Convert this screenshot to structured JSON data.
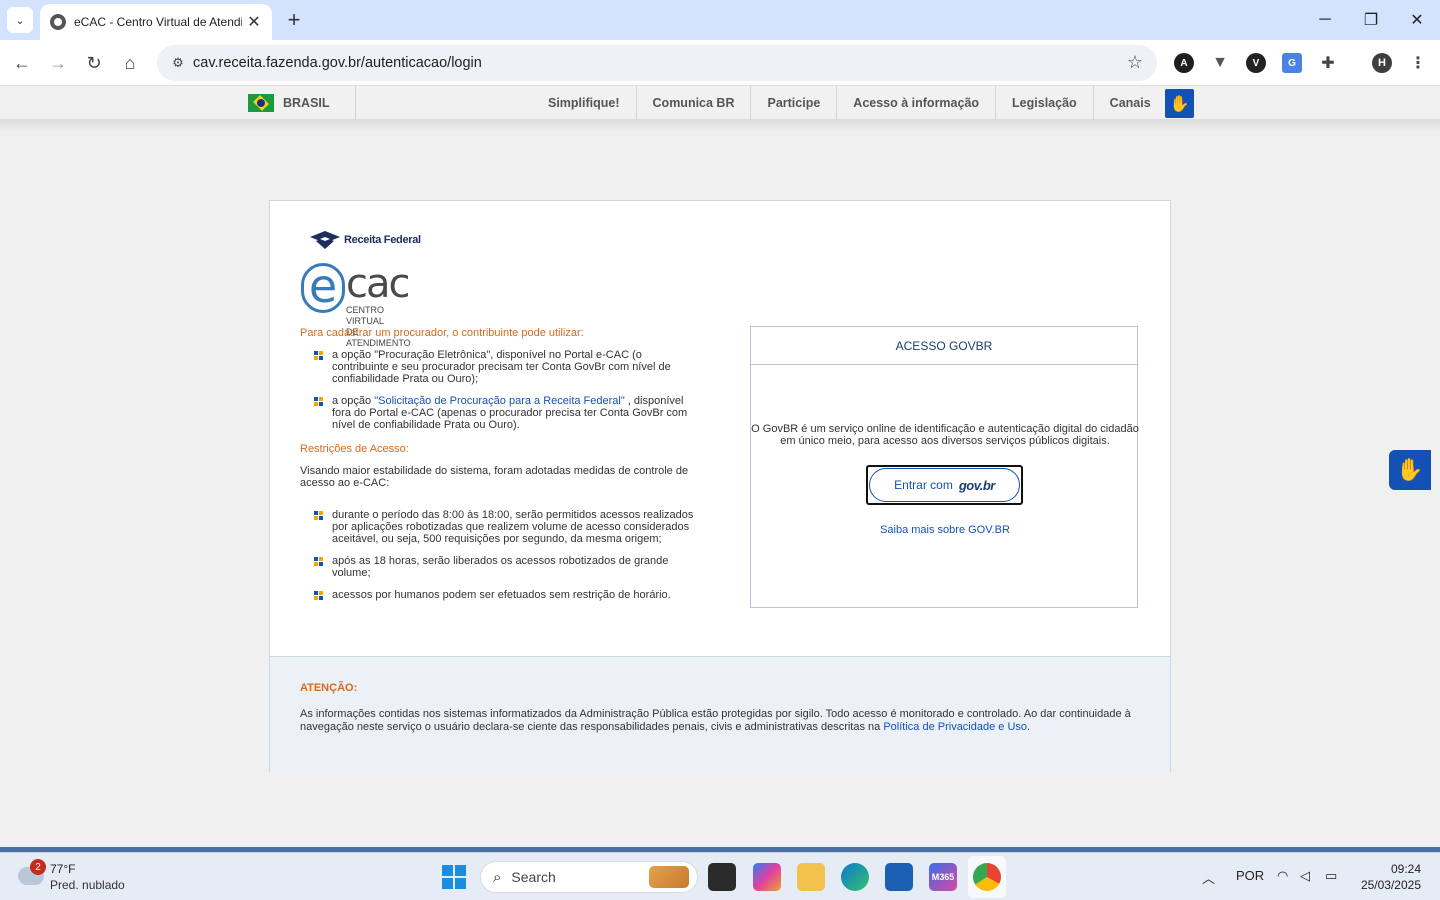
{
  "browser": {
    "tab_title": "eCAC - Centro Virtual de Atendimento",
    "url": "cav.receita.fazenda.gov.br/autenticacao/login",
    "profile_initial": "H"
  },
  "govbar": {
    "brasil": "BRASIL",
    "links": [
      "Simplifique!",
      "Comunica BR",
      "Participe",
      "Acesso à informação",
      "Legislação",
      "Canais"
    ]
  },
  "logo": {
    "receita": "Receita Federal",
    "ecac_text": "cac",
    "ecac_e": "e",
    "ecac_sub1": "CENTRO VIRTUAL",
    "ecac_sub2": "DE ATENDIMENTO"
  },
  "left": {
    "procurador_title": "Para cadastrar um procurador, o contribuinte pode utilizar:",
    "bullet1": "a opção \"Procuração Eletrônica\", disponível no Portal e-CAC (o contribuinte e seu procurador precisam ter Conta GovBr com nível de confiabilidade Prata ou Ouro);",
    "bullet2_prefix": "a opção ",
    "bullet2_link": "\"Solicitação de Procuração para a Receita Federal\"",
    "bullet2_suffix": " , disponível fora do Portal e-CAC (apenas o procurador precisa ter Conta GovBr com nível de confiabilidade Prata ou Ouro).",
    "restricoes_title": "Restrições de Acesso:",
    "restricoes_intro": "Visando maior estabilidade do sistema, foram adotadas medidas de controle de acesso ao e-CAC:",
    "rule1": "durante o período das 8:00 às 18:00, serão permitidos acessos realizados por aplicações robotizadas que realizem volume de acesso considerados aceitável, ou seja, 500 requisições por segundo, da mesma origem;",
    "rule2": "após as 18 horas, serão liberados os acessos robotizados de grande volume;",
    "rule3": "acessos por humanos podem ser efetuados sem restrição de horário."
  },
  "govbox": {
    "title": "ACESSO GOVBR",
    "description": "O GovBR é um serviço online de identificação e autenticação digital do cidadão em único meio, para acesso aos diversos serviços públicos digitais.",
    "button_label": "Entrar com",
    "button_logo": "gov.br",
    "saiba_mais": "Saiba mais sobre GOV.BR"
  },
  "footer": {
    "atencao": "ATENÇÃO:",
    "text": "As informações contidas nos sistemas informatizados da Administração Pública estão protegidas por sigilo. Todo acesso é monitorado e controlado. Ao dar continuidade à navegação neste serviço o usuário declara-se ciente das responsabilidades penais, civis e administrativas descritas na ",
    "link": "Política de Privacidade e Uso",
    "end": "."
  },
  "taskbar": {
    "weather_badge": "2",
    "weather_temp": "77°F",
    "weather_desc": "Pred. nublado",
    "search": "Search",
    "lang": "POR",
    "time": "09:24",
    "date": "25/03/2025",
    "m365_label": "M365"
  },
  "colors": {
    "accent_blue": "#1351b4",
    "orange": "#d86a1a"
  }
}
